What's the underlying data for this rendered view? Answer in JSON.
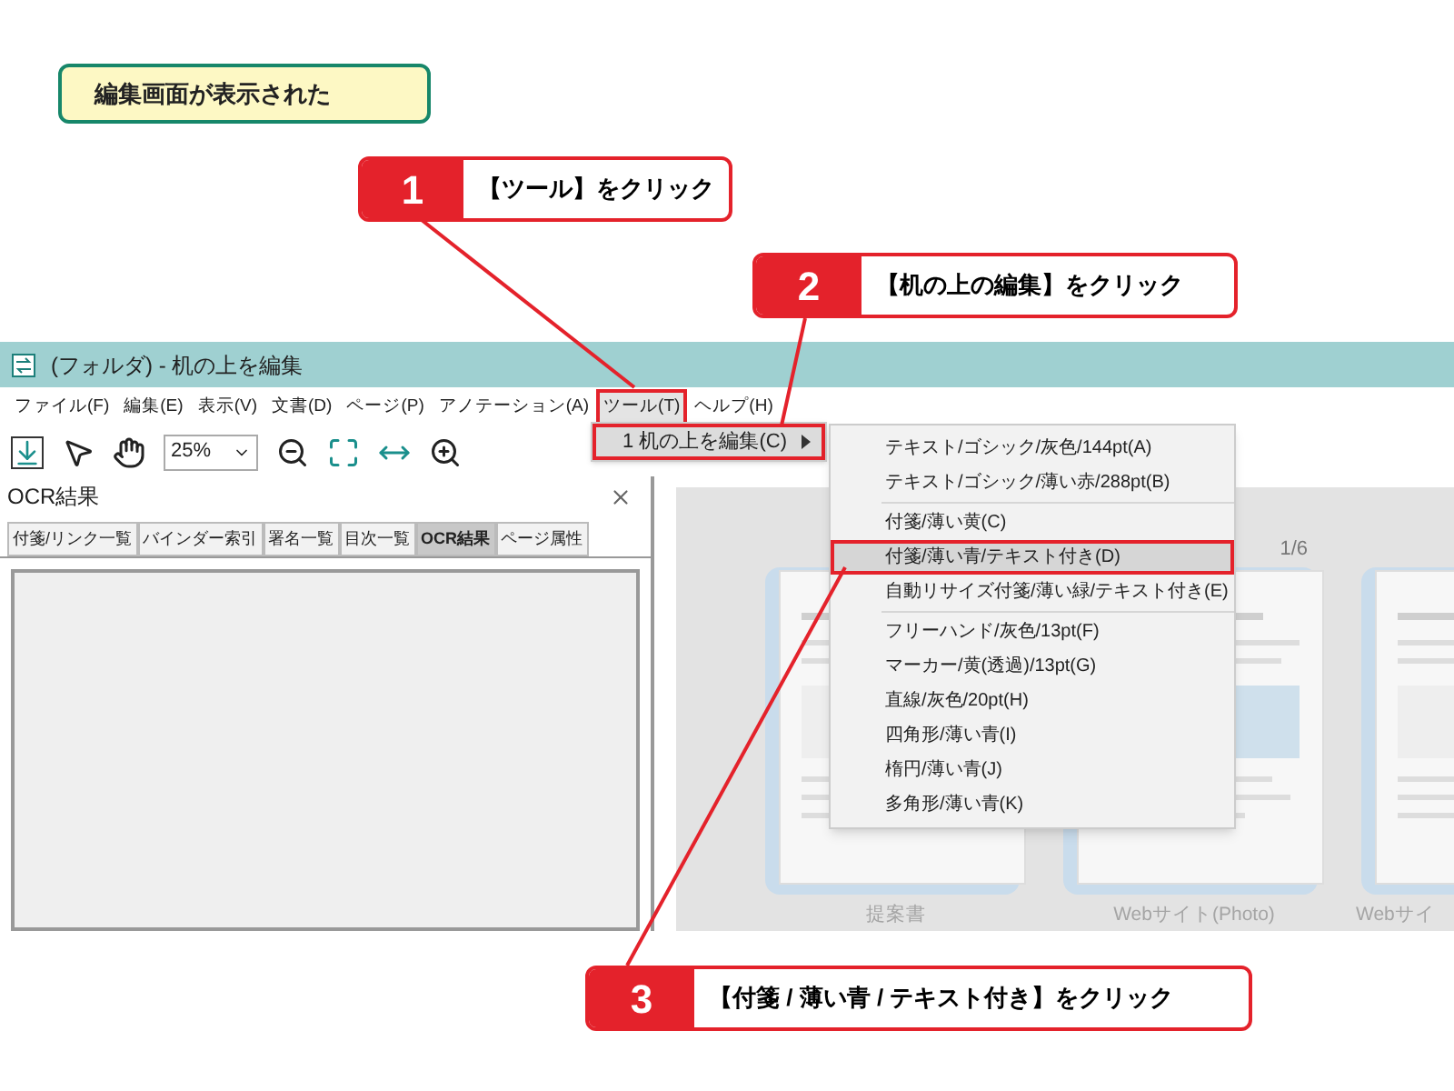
{
  "heading": "編集画面が表示された",
  "callouts": [
    {
      "number": "1",
      "text": "【ツール】をクリック"
    },
    {
      "number": "2",
      "text": "【机の上の編集】をクリック"
    },
    {
      "number": "3",
      "text": "【付箋 / 薄い青 / テキスト付き】をクリック"
    }
  ],
  "window": {
    "title": "(フォルダ) - 机の上を編集"
  },
  "menu_bar": [
    {
      "label": "ファイル(F)",
      "selected": false
    },
    {
      "label": "編集(E)",
      "selected": false
    },
    {
      "label": "表示(V)",
      "selected": false
    },
    {
      "label": "文書(D)",
      "selected": false
    },
    {
      "label": "ページ(P)",
      "selected": false
    },
    {
      "label": "アノテーション(A)",
      "selected": false
    },
    {
      "label": "ツール(T)",
      "selected": true
    },
    {
      "label": "ヘルプ(H)",
      "selected": false
    }
  ],
  "tool_menu": [
    {
      "label": "1 机の上を編集(C)",
      "selected": true
    }
  ],
  "submenu_groups": [
    {
      "items": [
        {
          "label": "テキスト/ゴシック/灰色/144pt(A)",
          "selected": false
        },
        {
          "label": "テキスト/ゴシック/薄い赤/288pt(B)",
          "selected": false
        }
      ]
    },
    {
      "items": [
        {
          "label": "付箋/薄い黄(C)",
          "selected": false
        },
        {
          "label": "付箋/薄い青/テキスト付き(D)",
          "selected": true
        },
        {
          "label": "自動リサイズ付箋/薄い緑/テキスト付き(E)",
          "selected": false
        }
      ]
    },
    {
      "items": [
        {
          "label": "フリーハンド/灰色/13pt(F)",
          "selected": false
        },
        {
          "label": "マーカー/黄(透過)/13pt(G)",
          "selected": false
        },
        {
          "label": "直線/灰色/20pt(H)",
          "selected": false
        },
        {
          "label": "四角形/薄い青(I)",
          "selected": false
        },
        {
          "label": "楕円/薄い青(J)",
          "selected": false
        },
        {
          "label": "多角形/薄い青(K)",
          "selected": false
        }
      ]
    }
  ],
  "toolbar": {
    "zoom": "25%"
  },
  "panel": {
    "title": "OCR結果",
    "tabs": [
      {
        "label": "付箋/リンク一覧",
        "selected": false
      },
      {
        "label": "バインダー索引",
        "selected": false
      },
      {
        "label": "署名一覧",
        "selected": false
      },
      {
        "label": "目次一覧",
        "selected": false
      },
      {
        "label": "OCR結果",
        "selected": true
      },
      {
        "label": "ページ属性",
        "selected": false
      }
    ]
  },
  "thumbnails": [
    {
      "label": "提案書"
    },
    {
      "label": "Webサイト(Photo)",
      "page": "1/6"
    },
    {
      "label": "Webサイ"
    }
  ]
}
